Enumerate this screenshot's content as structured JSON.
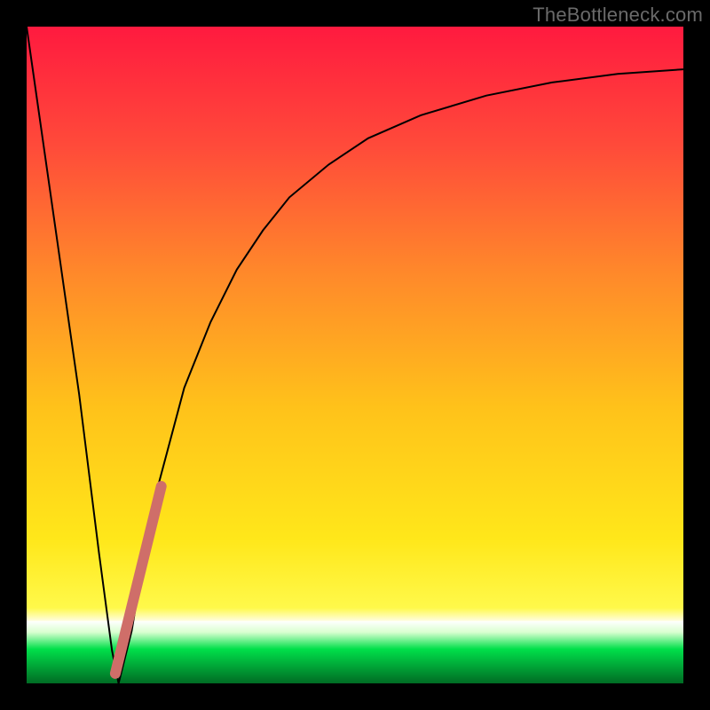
{
  "watermark": "TheBottleneck.com",
  "chart_data": {
    "type": "line",
    "title": "",
    "xlabel": "",
    "ylabel": "",
    "xlim": [
      0,
      100
    ],
    "ylim": [
      0,
      100
    ],
    "grid": false,
    "series": [
      {
        "name": "bottleneck-curve",
        "color": "#000000",
        "stroke_width": 2,
        "x": [
          0,
          4,
          8,
          11,
          13,
          14,
          16,
          18,
          20,
          24,
          28,
          32,
          36,
          40,
          46,
          52,
          60,
          70,
          80,
          90,
          100
        ],
        "values": [
          100,
          72,
          44,
          20,
          5,
          0,
          8,
          20,
          30,
          45,
          55,
          63,
          69,
          74,
          79,
          83,
          86.5,
          89.5,
          91.5,
          92.8,
          93.5
        ]
      },
      {
        "name": "highlight-segment",
        "color": "#cf6e69",
        "stroke_width": 12,
        "linecap": "round",
        "x": [
          13.5,
          20.5
        ],
        "values": [
          1.5,
          30.0
        ]
      }
    ],
    "background_gradient": {
      "main_stops": [
        {
          "offset": 0.0,
          "color": "#ff1a3f"
        },
        {
          "offset": 0.18,
          "color": "#ff4a3a"
        },
        {
          "offset": 0.38,
          "color": "#ff8a2a"
        },
        {
          "offset": 0.58,
          "color": "#ffc21a"
        },
        {
          "offset": 0.78,
          "color": "#ffe71a"
        },
        {
          "offset": 0.885,
          "color": "#fff94a"
        },
        {
          "offset": 0.905,
          "color": "#fffde0"
        }
      ],
      "band_top": 0.905,
      "band_bottom": 0.975,
      "green": "#00e04a",
      "bottom_fade_to": "#006b24"
    }
  }
}
